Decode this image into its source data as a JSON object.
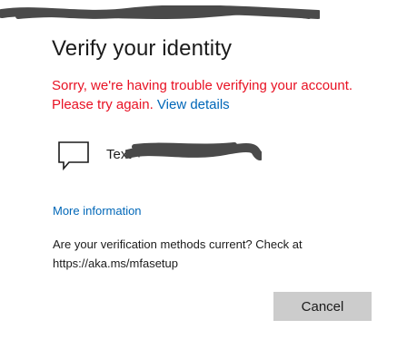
{
  "dialog": {
    "title": "Verify your identity",
    "error_message": "Sorry, we're having trouble verifying your account. Please try again.",
    "view_details_link": "View details",
    "verification_method": {
      "icon": "chat-message-icon",
      "label": "Text +"
    },
    "more_information_link": "More information",
    "methods_current_text": "Are your verification methods current? Check at https://aka.ms/mfasetup",
    "cancel_button": "Cancel"
  },
  "colors": {
    "error": "#e81123",
    "link": "#0067b8",
    "button_bg": "#cccccc",
    "text": "#1b1b1b"
  }
}
